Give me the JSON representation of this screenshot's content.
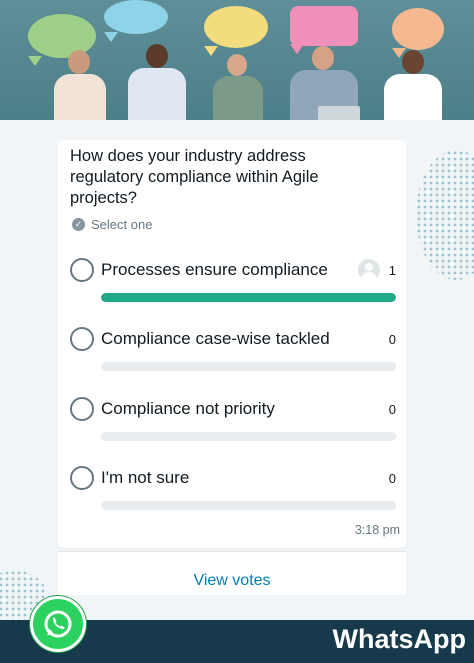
{
  "poll": {
    "question": "How does your industry address regulatory compliance within Agile projects?",
    "select_hint": "Select one",
    "options": [
      {
        "label": "Processes ensure compliance",
        "count": "1",
        "fill": 1.0
      },
      {
        "label": "Compliance case-wise tackled",
        "count": "0",
        "fill": 0
      },
      {
        "label": "Compliance not priority",
        "count": "0",
        "fill": 0
      },
      {
        "label": "I'm not sure",
        "count": "0",
        "fill": 0
      }
    ],
    "time": "3:18 pm",
    "view_votes": "View votes"
  },
  "brand": {
    "name": "WhatsApp"
  },
  "colors": {
    "accent_green": "#21a884",
    "link_blue": "#027eb5",
    "footer_bar": "#163a4b",
    "whatsapp_green": "#2bd25f"
  },
  "icons": {
    "select_hint": "check-circle-icon",
    "voter": "avatar-icon",
    "brand": "whatsapp-logo-icon"
  }
}
